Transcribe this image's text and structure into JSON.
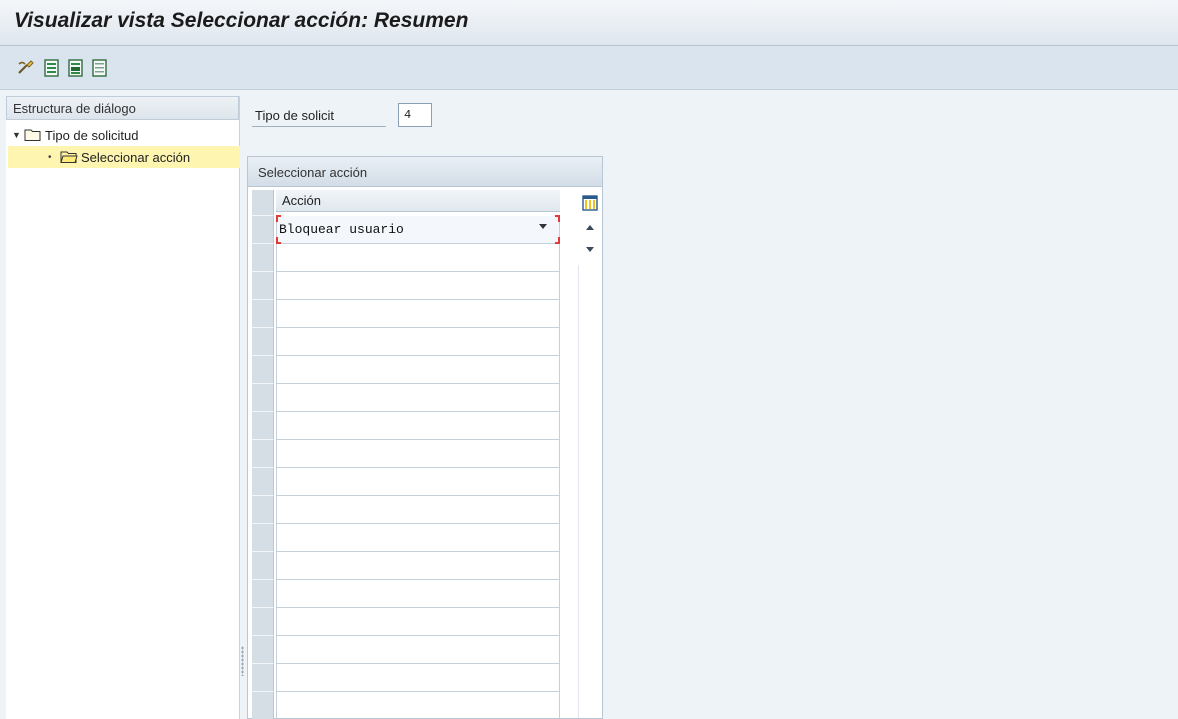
{
  "window": {
    "title": "Visualizar vista Seleccionar acción: Resumen"
  },
  "toolbar": {
    "buttons": [
      {
        "name": "display-change-icon"
      },
      {
        "name": "select-all-icon"
      },
      {
        "name": "select-block-icon"
      },
      {
        "name": "deselect-all-icon"
      }
    ]
  },
  "dialog_structure": {
    "header": "Estructura de diálogo",
    "nodes": [
      {
        "label": "Tipo de solicitud",
        "expanded": true
      },
      {
        "label": "Seleccionar acción",
        "selected": true
      }
    ]
  },
  "filter": {
    "label": "Tipo de solicit",
    "value": "4"
  },
  "table": {
    "title": "Seleccionar acción",
    "column_header": "Acción",
    "rows": [
      "Bloquear usuario"
    ],
    "empty_row_count": 17
  },
  "colors": {
    "title_bar": "#e8eef4",
    "toolbar": "#dae4ee",
    "selected_node": "#fdf5b0",
    "required_marker": "#e03a3a"
  }
}
